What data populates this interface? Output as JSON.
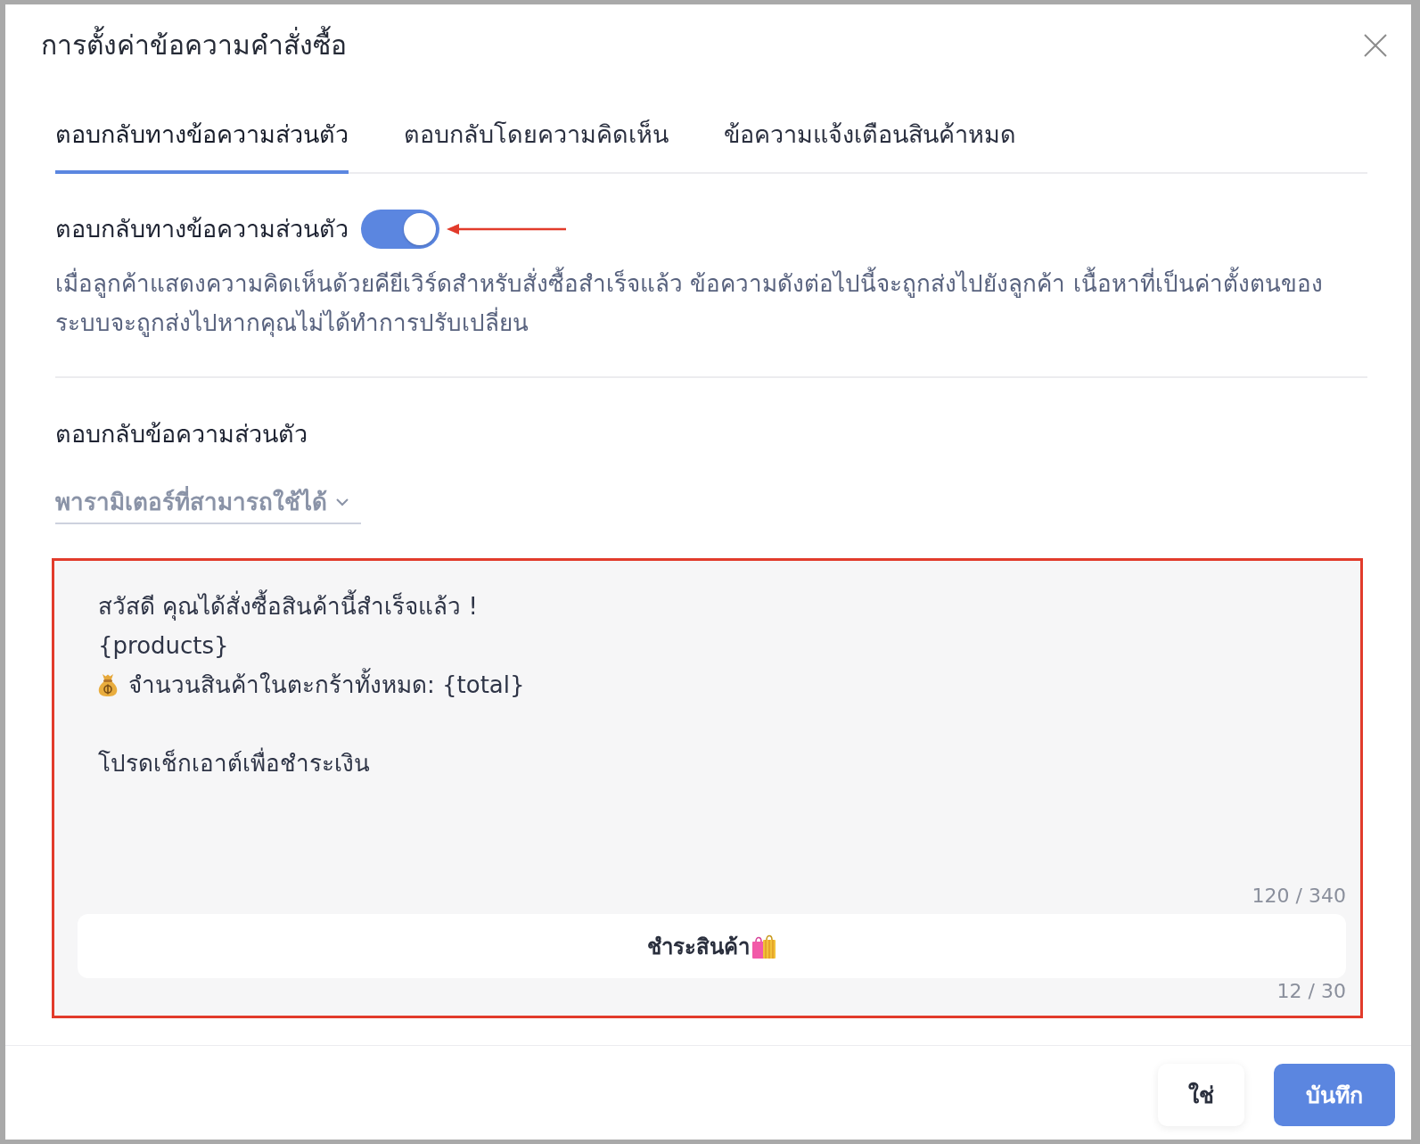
{
  "dialog": {
    "title": "การตั้งค่าข้อความคำสั่งซื้อ"
  },
  "tabs": [
    {
      "label": "ตอบกลับทางข้อความส่วนตัว",
      "selected": true
    },
    {
      "label": "ตอบกลับโดยความคิดเห็น",
      "selected": false
    },
    {
      "label": "ข้อความแจ้งเตือนสินค้าหมด",
      "selected": false
    }
  ],
  "private_reply": {
    "label": "ตอบกลับทางข้อความส่วนตัว",
    "on": true,
    "description": "เมื่อลูกค้าแสดงความคิดเห็นด้วยคียีเวิร์ดสำหรับสั่งซื้อสำเร็จแล้ว ข้อความดังต่อไปนี้จะถูกส่งไปยังลูกค้า เนื้อหาที่เป็นค่าตั้งตนของระบบจะถูกส่งไปหากคุณไม่ได้ทำการปรับเปลี่ยน"
  },
  "reply_message": {
    "label": "ตอบกลับข้อความส่วนตัว",
    "parameters": {
      "label": "พารามิเตอร์ที่สามารถใช้ได้"
    },
    "lines": [
      {
        "kind": "text",
        "text": "สวัสดี คุณได้สั่งซื้อสินค้านี้สำเร็จแล้ว !"
      },
      {
        "kind": "text",
        "text": "{products}"
      },
      {
        "kind": "icon_text",
        "text": "จำนวนสินค้าในตะกร้าทั้งหมด: {total}"
      },
      {
        "kind": "gap"
      },
      {
        "kind": "text",
        "text": "โปรดเช็กเอาต์เพื่อชำระเงิน"
      }
    ],
    "counter": "120 / 340",
    "button": {
      "text": "ชำระสินค้า",
      "counter": "12 / 30"
    }
  },
  "footer": {
    "buttons": [
      {
        "label": "ใช่",
        "kind": "secondary"
      },
      {
        "label": "บันทึก",
        "kind": "primary"
      }
    ]
  }
}
